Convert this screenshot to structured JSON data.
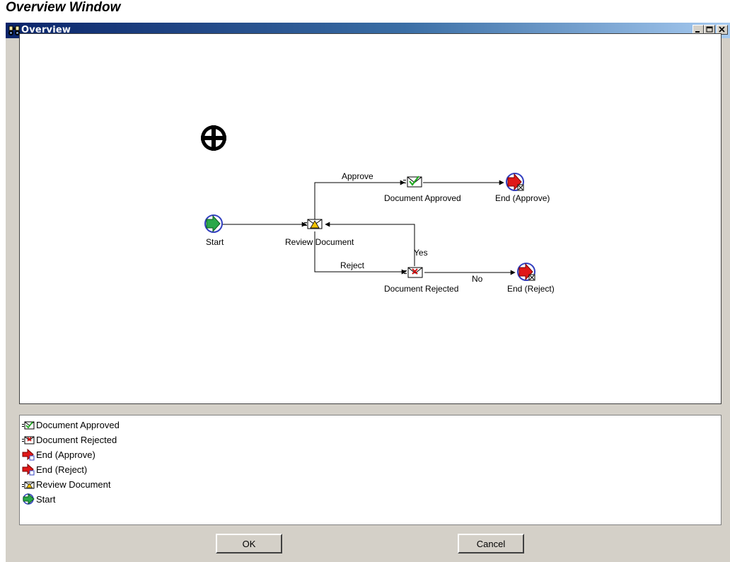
{
  "caption": "Overview Window",
  "window": {
    "title": "Overview",
    "controls": [
      "minimize-icon",
      "maximize-icon",
      "close-icon"
    ]
  },
  "diagram": {
    "nodes": [
      {
        "id": "start",
        "label": "Start",
        "icon": "start-icon"
      },
      {
        "id": "review",
        "label": "Review Document",
        "icon": "notification-warning-icon"
      },
      {
        "id": "approved",
        "label": "Document Approved",
        "icon": "notification-approved-icon"
      },
      {
        "id": "rejected",
        "label": "Document Rejected",
        "icon": "notification-rejected-icon"
      },
      {
        "id": "end_approve",
        "label": "End (Approve)",
        "icon": "end-icon"
      },
      {
        "id": "end_reject",
        "label": "End (Reject)",
        "icon": "end-icon"
      }
    ],
    "edges": [
      {
        "from": "start",
        "to": "review",
        "label": ""
      },
      {
        "from": "review",
        "to": "approved",
        "label": "Approve"
      },
      {
        "from": "review",
        "to": "rejected",
        "label": "Reject"
      },
      {
        "from": "approved",
        "to": "end_approve",
        "label": ""
      },
      {
        "from": "rejected",
        "to": "review",
        "label": "Yes"
      },
      {
        "from": "rejected",
        "to": "end_reject",
        "label": "No"
      }
    ],
    "labels": {
      "start": "Start",
      "review": "Review Document",
      "approved": "Document Approved",
      "rejected": "Document Rejected",
      "end_approve": "End (Approve)",
      "end_reject": "End (Reject)",
      "edge_approve": "Approve",
      "edge_reject": "Reject",
      "edge_yes": "Yes",
      "edge_no": "No"
    }
  },
  "list": {
    "items": [
      {
        "label": "Document Approved",
        "icon": "notification-approved-icon"
      },
      {
        "label": "Document Rejected",
        "icon": "notification-rejected-icon"
      },
      {
        "label": "End (Approve)",
        "icon": "end-icon"
      },
      {
        "label": "End (Reject)",
        "icon": "end-icon"
      },
      {
        "label": "Review Document",
        "icon": "notification-warning-icon"
      },
      {
        "label": "Start",
        "icon": "start-icon"
      }
    ]
  },
  "buttons": {
    "ok": "OK",
    "cancel": "Cancel"
  }
}
